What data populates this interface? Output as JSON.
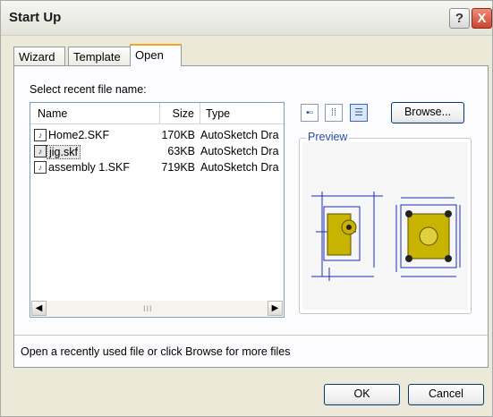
{
  "window": {
    "title": "Start Up"
  },
  "titlebar": {
    "help_label": "?",
    "close_label": "X"
  },
  "tabs": [
    {
      "label": "Wizard"
    },
    {
      "label": "Template"
    },
    {
      "label": "Open",
      "selected": true
    }
  ],
  "open_tab": {
    "section_label": "Select recent file name:",
    "columns": [
      "Name",
      "Size",
      "Type"
    ],
    "files": [
      {
        "name": "Home2.SKF",
        "size": "170KB",
        "type": "AutoSketch Dra"
      },
      {
        "name": "jig.skf",
        "size": "63KB",
        "type": "AutoSketch Dra",
        "selected": true
      },
      {
        "name": "assembly 1.SKF",
        "size": "719KB",
        "type": "AutoSketch Dra"
      }
    ],
    "scroll_left": "◀",
    "scroll_right": "▶",
    "scroll_grip": "III",
    "view_buttons": [
      {
        "icon": "large-icons-view-icon",
        "glyph": "▪▫"
      },
      {
        "icon": "small-icons-view-icon",
        "glyph": "⁞⁞"
      },
      {
        "icon": "details-view-icon",
        "glyph": "☰",
        "active": true
      }
    ],
    "browse_label": "Browse...",
    "preview_label": "Preview",
    "status_text": "Open a recently used file or click Browse for more files"
  },
  "footer": {
    "ok_label": "OK",
    "cancel_label": "Cancel"
  },
  "colors": {
    "accent": "#f5a623",
    "preview_text": "#2a4ea0",
    "drawing_lines": "#1c2db8",
    "drawing_fill": "#c8b400"
  }
}
